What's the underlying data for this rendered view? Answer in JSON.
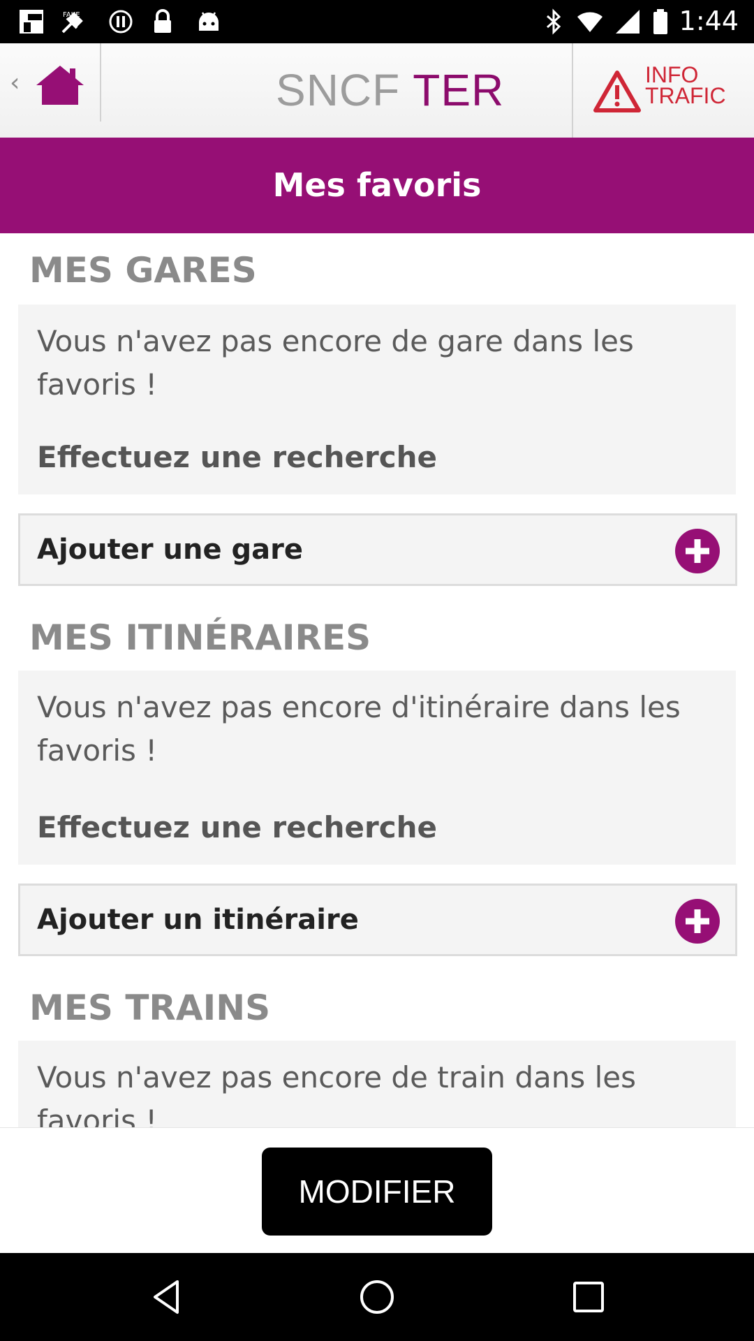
{
  "status_bar": {
    "time": "1:44",
    "left_icons": [
      "flipboard-icon",
      "fake-gps-icon",
      "sync-icon",
      "lock-icon",
      "android-icon"
    ],
    "right_icons": [
      "bluetooth-icon",
      "wifi-icon",
      "signal-icon",
      "battery-icon"
    ]
  },
  "header": {
    "logo_sncf": "SNCF",
    "logo_ter": "TER",
    "info_line1": "INFO",
    "info_line2": "TRAFIC"
  },
  "page_title": "Mes favoris",
  "sections": {
    "gares": {
      "title": "MES GARES",
      "empty_message": "Vous n'avez pas encore de gare dans les favoris !",
      "call_to_action": "Effectuez une recherche",
      "add_label": "Ajouter une gare"
    },
    "itineraires": {
      "title": "MES ITINÉRAIRES",
      "empty_message": "Vous n'avez pas encore d'itinéraire dans les favoris !",
      "call_to_action": "Effectuez une recherche",
      "add_label": "Ajouter un itinéraire"
    },
    "trains": {
      "title": "MES TRAINS",
      "empty_message": "Vous n'avez pas encore de train dans les favoris !"
    }
  },
  "bottom": {
    "modify_label": "MODIFIER"
  },
  "colors": {
    "brand": "#960f75",
    "alert": "#cf2636",
    "section_gray": "#8a8a8a"
  }
}
